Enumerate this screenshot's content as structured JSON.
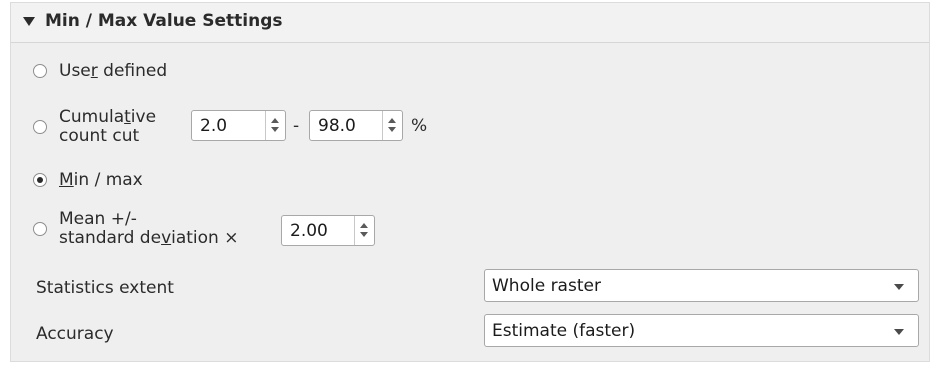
{
  "group": {
    "title": "Min / Max Value Settings"
  },
  "options": {
    "user_defined": {
      "pre": "Use",
      "key": "r",
      "post": " defined",
      "checked": false
    },
    "cumulative": {
      "line1_pre": "Cumula",
      "line1_key": "t",
      "line1_post": "ive",
      "line2": "count cut",
      "checked": false,
      "min_value": "2.0",
      "separator": "-",
      "max_value": "98.0",
      "unit": "%"
    },
    "min_max": {
      "key": "M",
      "post": "in / max",
      "checked": true
    },
    "mean_std": {
      "line1": "Mean +/-",
      "line2_pre": "standard de",
      "line2_key": "v",
      "line2_post": "iation ×",
      "checked": false,
      "value": "2.00"
    }
  },
  "statistics_extent": {
    "label": "Statistics extent",
    "value": "Whole raster"
  },
  "accuracy": {
    "label": "Accuracy",
    "value": "Estimate (faster)"
  }
}
